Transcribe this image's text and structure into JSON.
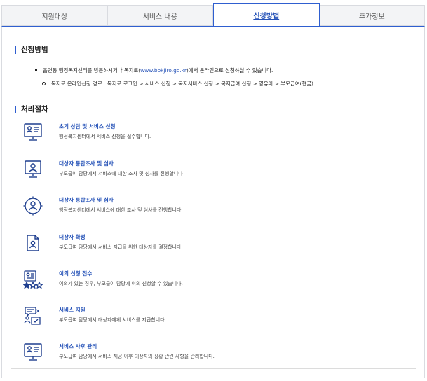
{
  "tabs": [
    {
      "label": "지원대상"
    },
    {
      "label": "서비스 내용"
    },
    {
      "label": "신청방법"
    },
    {
      "label": "추가정보"
    }
  ],
  "apply": {
    "title": "신청방법",
    "bullet_prefix": "읍면동 행정복지센터를 방문하시거나 복지로(",
    "bullet_link": "www.bokjiro.go.kr",
    "bullet_suffix": ")에서 온라인으로 신청하실 수 있습니다.",
    "sub_bullet": "복지로 온라인신청 경로 : 복지로 로그인 > 서비스 신청 > 복지서비스 신청 > 복지급여 신청 > 영유아 > 부모급여(현금)"
  },
  "process": {
    "title": "처리절차",
    "steps": [
      {
        "icon": "consult-monitor-icon",
        "title": "초기 상담 및 서비스 신청",
        "desc": "행정복지센터에서 서비스 신청을 접수합니다."
      },
      {
        "icon": "person-screen-icon",
        "title": "대상자 통합조사 및 심사",
        "desc": "부모급여 담당에서 서비스에 대한 조사 및 심사를 진행합니다"
      },
      {
        "icon": "person-target-icon",
        "title": "대상자 통합조사 및 심사",
        "desc": "행정복지센터에서 서비스에 대한 조사 및 심사를 진행합니다"
      },
      {
        "icon": "document-person-icon",
        "title": "대상자 확정",
        "desc": "부모급여 담당에서 서비스 지급을 위한 대상자를 결정합니다."
      },
      {
        "icon": "rating-stars-icon",
        "title": "이의 신청 접수",
        "desc": "이의가 있는 경우, 부모급여 담당에 이의 신청할 수 있습니다."
      },
      {
        "icon": "service-support-icon",
        "title": "서비스 지원",
        "desc": "부모급여 담당에서 대상자에게 서비스를 지급합니다."
      },
      {
        "icon": "consult-monitor-icon",
        "title": "서비스 사후 관리",
        "desc": "부모급여 담당에서 서비스 제공 이후 대상자의 상황 관련 사항을 관리합니다."
      }
    ]
  },
  "colors": {
    "accent": "#2f5fd0",
    "link": "#2451b7",
    "icon": "#1f3f8f"
  }
}
